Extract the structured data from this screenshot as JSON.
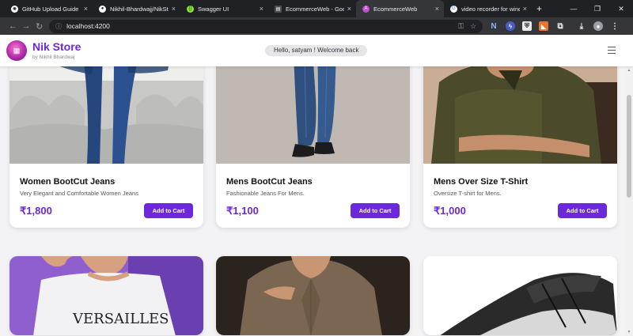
{
  "browser": {
    "tabs": [
      {
        "title": "GitHub Upload Guide",
        "color": "#ffffff"
      },
      {
        "title": "Nikhil-Bhardwajj/NikStore",
        "color": "#ffffff"
      },
      {
        "title": "Swagger UI",
        "color": "#85ea2d"
      },
      {
        "title": "EcommerceWeb - Google",
        "color": "#ffffff"
      },
      {
        "title": "EcommerceWeb",
        "color": "#c44ad6"
      },
      {
        "title": "video recorder for window",
        "color": "#ffffff"
      }
    ],
    "new_tab": "+",
    "url": "localhost:4200"
  },
  "header": {
    "brand_name": "Nik Store",
    "brand_by": "by Nikhil Bhardwaj",
    "welcome": "Hello, satyam ! Welcome back"
  },
  "products": [
    {
      "name": "Women BootCut Jeans",
      "desc": "Very Elegant and Comfortable Women Jeans",
      "price": "₹1,800",
      "button": "Add to Cart"
    },
    {
      "name": "Mens BootCut Jeans",
      "desc": "Fashionable Jeans For Mens.",
      "price": "₹1,100",
      "button": "Add to Cart"
    },
    {
      "name": "Mens Over Size T-Shirt",
      "desc": "Oversize T-shirt for Mens.",
      "price": "₹1,000",
      "button": "Add to Cart"
    }
  ],
  "tshirt_print": "VERSAILLES",
  "colors": {
    "accent": "#6d28d9",
    "chrome": "#202124"
  }
}
